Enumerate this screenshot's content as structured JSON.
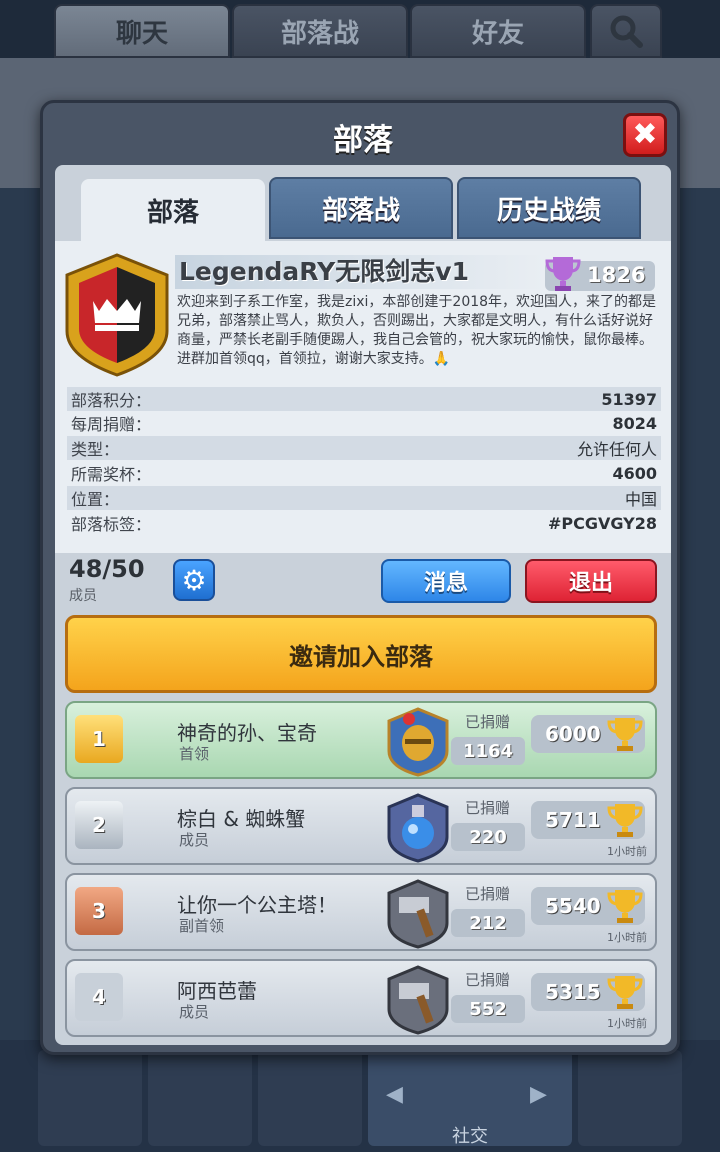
{
  "top_tabs": [
    "聊天",
    "部落战",
    "好友"
  ],
  "dialog": {
    "title": "部落",
    "close_label": "✖",
    "tabs": [
      "部落",
      "部落战",
      "历史战绩"
    ]
  },
  "clan": {
    "name": "LegendaRY无限剑志v1",
    "trophies": "1826",
    "description": "欢迎来到子系工作室，我是zixi，本部创建于2018年，欢迎国人，来了的都是兄弟，部落禁止骂人，欺负人，否则踢出，大家都是文明人，有什么话好说好商量，严禁长老副手随便踢人，我自己会管的，祝大家玩的愉快，鼠你最棒。进群加首领qq，首领拉，谢谢大家支持。🙏",
    "stats": [
      {
        "label": "部落积分：",
        "value": "51397"
      },
      {
        "label": "每周捐赠：",
        "value": "8024"
      },
      {
        "label": "类型：",
        "value": "允许任何人"
      },
      {
        "label": "所需奖杯：",
        "value": "4600"
      },
      {
        "label": "位置：",
        "value": "中国"
      },
      {
        "label": "部落标签：",
        "value": "#PCGVGY28"
      }
    ]
  },
  "members_bar": {
    "count": "48/50",
    "count_label": "成员",
    "message_button": "消息",
    "leave_button": "退出"
  },
  "invite_button": "邀请加入部落",
  "members": [
    {
      "rank": "1",
      "name": "神奇的孙、宝奇",
      "role": "首领",
      "donated_label": "已捐赠",
      "donated": "1164",
      "trophies": "6000",
      "last_seen": ""
    },
    {
      "rank": "2",
      "name": "棕白 & 蜘蛛蟹",
      "role": "成员",
      "donated_label": "已捐赠",
      "donated": "220",
      "trophies": "5711",
      "last_seen": "1小时前"
    },
    {
      "rank": "3",
      "name": "让你一个公主塔！",
      "role": "副首领",
      "donated_label": "已捐赠",
      "donated": "212",
      "trophies": "5540",
      "last_seen": "1小时前"
    },
    {
      "rank": "4",
      "name": "阿西芭蕾",
      "role": "成员",
      "donated_label": "已捐赠",
      "donated": "552",
      "trophies": "5315",
      "last_seen": "1小时前"
    }
  ],
  "bottom_nav": {
    "active_label": "社交"
  }
}
